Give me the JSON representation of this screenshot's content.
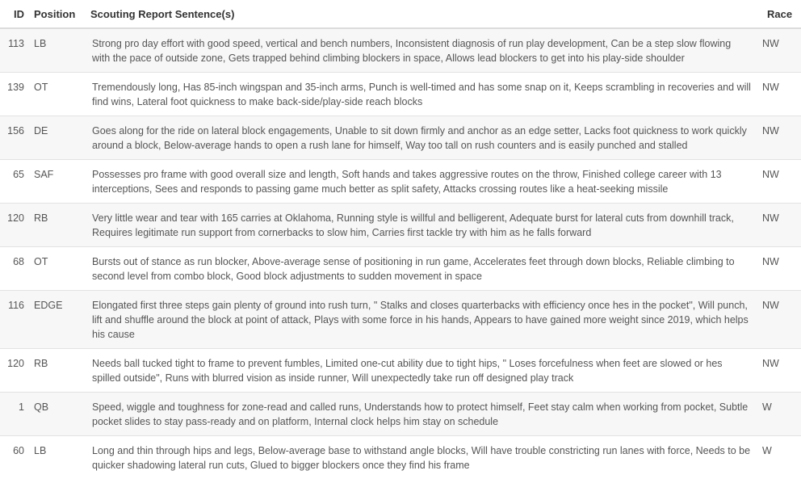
{
  "table": {
    "headers": {
      "id": "ID",
      "position": "Position",
      "report": "Scouting Report Sentence(s)",
      "race": "Race"
    },
    "rows": [
      {
        "id": "113",
        "position": "LB",
        "report": "Strong pro day effort with good speed, vertical and bench numbers, Inconsistent diagnosis of run play development, Can be a step slow flowing with the pace of outside zone, Gets trapped behind climbing blockers in space, Allows lead blockers to get into his play-side shoulder",
        "race": "NW"
      },
      {
        "id": "139",
        "position": "OT",
        "report": "Tremendously long, Has 85-inch wingspan and 35-inch arms, Punch is well-timed and has some snap on it, Keeps scrambling in recoveries and will find wins, Lateral foot quickness to make back-side/play-side reach blocks",
        "race": "NW"
      },
      {
        "id": "156",
        "position": "DE",
        "report": "Goes along for the ride on lateral block engagements, Unable to sit down firmly and anchor as an edge setter, Lacks foot quickness to work quickly around a block, Below-average hands to open a rush lane for himself, Way too tall on rush counters and is easily punched and stalled",
        "race": "NW"
      },
      {
        "id": "65",
        "position": "SAF",
        "report": "Possesses pro frame with good overall size and length, Soft hands and takes aggressive routes on the throw, Finished college career with 13 interceptions, Sees and responds to passing game much better as split safety, Attacks crossing routes like a heat-seeking missile",
        "race": "NW"
      },
      {
        "id": "120",
        "position": "RB",
        "report": "Very little wear and tear with 165 carries at Oklahoma, Running style is willful and belligerent, Adequate burst for lateral cuts from downhill track, Requires legitimate run support from cornerbacks to slow him, Carries first tackle try with him as he falls forward",
        "race": "NW"
      },
      {
        "id": "68",
        "position": "OT",
        "report": "Bursts out of stance as run blocker, Above-average sense of positioning in run game, Accelerates feet through down blocks, Reliable climbing to second level from combo block, Good block adjustments to sudden movement in space",
        "race": "NW"
      },
      {
        "id": "116",
        "position": "EDGE",
        "report": "Elongated first three steps gain plenty of ground into rush turn, \" Stalks and closes quarterbacks with efficiency once hes in the pocket\", Will punch, lift and shuffle around the block at point of attack, Plays with some force in his hands, Appears to have gained more weight since 2019, which helps his cause",
        "race": "NW"
      },
      {
        "id": "120",
        "position": "RB",
        "report": "Needs ball tucked tight to frame to prevent fumbles, Limited one-cut ability due to tight hips, \" Loses forcefulness when feet are slowed or hes spilled outside\", Runs with blurred vision as inside runner, Will unexpectedly take run off designed play track",
        "race": "NW"
      },
      {
        "id": "1",
        "position": "QB",
        "report": "Speed, wiggle and toughness for zone-read and called runs, Understands how to protect himself, Feet stay calm when working from pocket, Subtle pocket slides to stay pass-ready and on platform, Internal clock helps him stay on schedule",
        "race": "W"
      },
      {
        "id": "60",
        "position": "LB",
        "report": "Long and thin through hips and legs, Below-average base to withstand angle blocks, Will have trouble constricting run lanes with force, Needs to be quicker shadowing lateral run cuts, Glued to bigger blockers once they find his frame",
        "race": "W"
      }
    ]
  }
}
